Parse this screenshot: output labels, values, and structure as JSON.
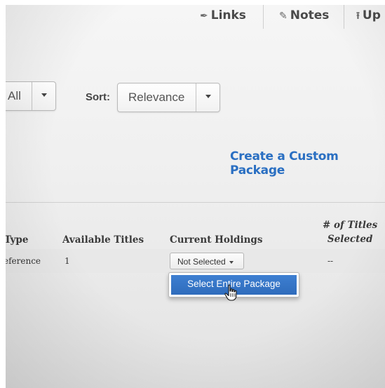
{
  "toolbar": {
    "links_label": "Links",
    "notes_label": "Notes",
    "upload_label": "Up",
    "links_icon": "paperclip-icon",
    "notes_icon": "note-edit-icon",
    "upload_icon": "upload-icon"
  },
  "filters": {
    "type_select_value": "All",
    "sort_label": "Sort:",
    "sort_select_value": "Relevance"
  },
  "custom_package_link": "Create a Custom Package",
  "table": {
    "headers": {
      "type": "Type",
      "available_titles": "Available Titles",
      "current_holdings": "Current Holdings",
      "num_titles_line1": "# of Titles",
      "num_titles_line2": "Selected"
    },
    "rows": [
      {
        "type": "eference",
        "available_titles": "1",
        "current_holdings": "Not Selected",
        "num_titles_selected": "--"
      }
    ]
  },
  "holdings_menu": {
    "items": [
      "Select Entire Package"
    ]
  },
  "colors": {
    "link": "#2a6fc2",
    "menu_highlight": "#3d7fd1"
  }
}
